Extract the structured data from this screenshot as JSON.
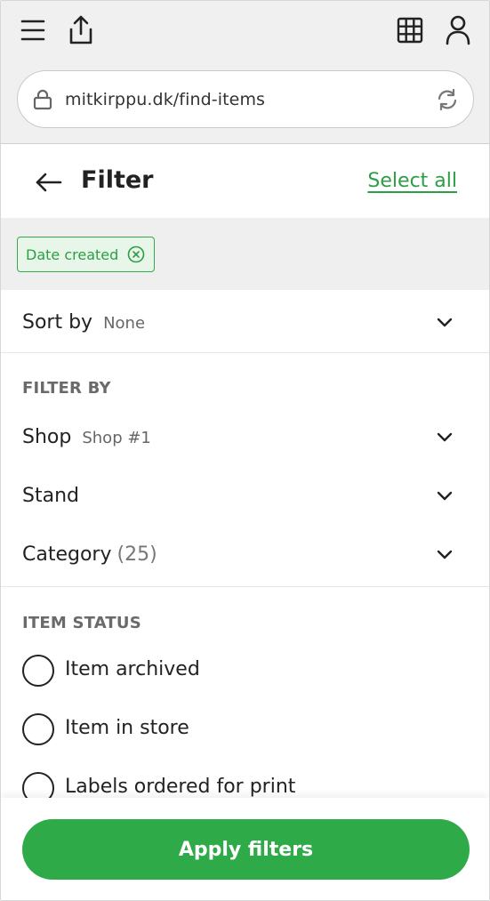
{
  "browser": {
    "url": "mitkirppu.dk/find-items"
  },
  "header": {
    "title": "Filter",
    "select_all_label": "Select all"
  },
  "active_filters": [
    {
      "label": "Date created"
    }
  ],
  "sort": {
    "label": "Sort by",
    "value": "None"
  },
  "filter_by": {
    "title": "FILTER BY",
    "items": [
      {
        "label": "Shop",
        "value": "Shop #1"
      },
      {
        "label": "Stand",
        "value": ""
      },
      {
        "label": "Category",
        "count": "(25)"
      }
    ]
  },
  "item_status": {
    "title": "ITEM STATUS",
    "options": [
      {
        "label": "Item archived"
      },
      {
        "label": "Item in store"
      },
      {
        "label": "Labels ordered for print"
      }
    ]
  },
  "footer": {
    "apply_label": "Apply filters"
  },
  "colors": {
    "accent": "#2faa48",
    "chip_bg": "#e8f6ea",
    "chip_border": "#36a84d"
  }
}
